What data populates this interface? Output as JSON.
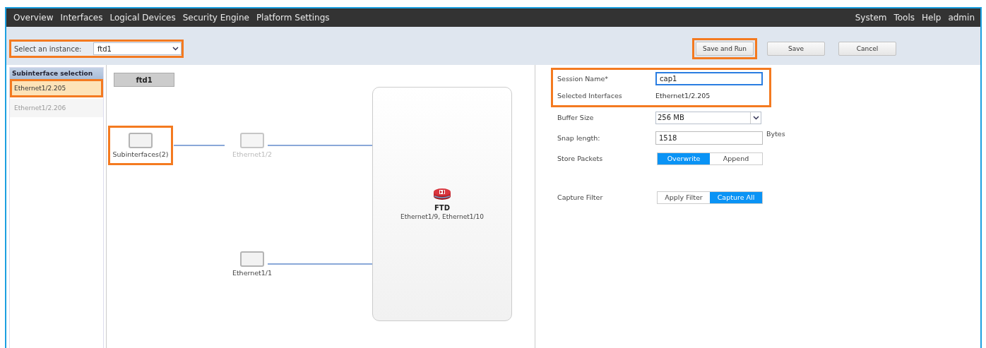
{
  "nav": {
    "left": [
      "Overview",
      "Interfaces",
      "Logical Devices",
      "Security Engine",
      "Platform Settings"
    ],
    "right": [
      "System",
      "Tools",
      "Help",
      "admin"
    ]
  },
  "instance": {
    "label": "Select an instance:",
    "value": "ftd1"
  },
  "buttons": [
    {
      "label": "Save and Run",
      "highlighted": true
    },
    {
      "label": "Save",
      "highlighted": false
    },
    {
      "label": "Cancel",
      "highlighted": false
    }
  ],
  "sidebar": {
    "title": "Subinterface selection",
    "items": [
      {
        "label": "Ethernet1/2.205",
        "selected": true,
        "disabled": false
      },
      {
        "label": "Ethernet1/2.206",
        "selected": false,
        "disabled": true
      }
    ]
  },
  "canvas": {
    "tab": "ftd1",
    "nodes": [
      {
        "label": "Subinterfaces(2)",
        "disabled": false,
        "highlighted": true
      },
      {
        "label": "Ethernet1/2",
        "disabled": true,
        "highlighted": false
      },
      {
        "label": "Ethernet1/1",
        "disabled": false,
        "highlighted": false
      }
    ],
    "device": {
      "name": "FTD",
      "interfaces": "Ethernet1/9, Ethernet1/10"
    }
  },
  "form": {
    "session_name": {
      "label": "Session Name*",
      "value": "cap1"
    },
    "selected_interfaces": {
      "label": "Selected Interfaces",
      "value": "Ethernet1/2.205"
    },
    "buffer_size": {
      "label": "Buffer Size",
      "value": "256 MB"
    },
    "snap_length": {
      "label": "Snap length:",
      "value": "1518",
      "unit": "Bytes"
    },
    "store_packets": {
      "label": "Store Packets",
      "options": [
        {
          "label": "Overwrite",
          "selected": true
        },
        {
          "label": "Append",
          "selected": false
        }
      ]
    },
    "capture_filter": {
      "label": "Capture Filter",
      "options": [
        {
          "label": "Apply Filter",
          "selected": false
        },
        {
          "label": "Capture All",
          "selected": true
        }
      ]
    }
  }
}
